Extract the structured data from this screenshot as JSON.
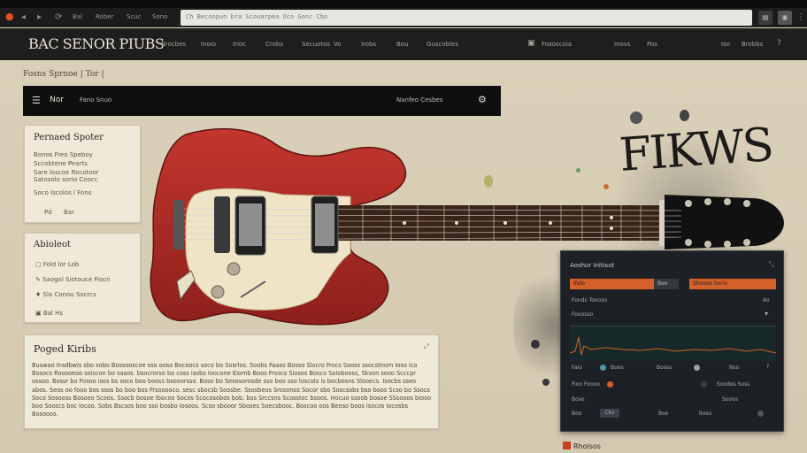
{
  "browser": {
    "url": "Ch   Beconpun bra Scouarpea Oco Gonc Cbo",
    "nav_links": [
      "Bal",
      "Rober",
      "Scuc",
      "Sono"
    ],
    "colors": {
      "tab_icon": "#e0501f"
    }
  },
  "site": {
    "logo": "BAC SENOR PIUBS",
    "nav": [
      "Brocbes",
      "Inoio",
      "Irioc",
      "Crobs",
      "Secuotos",
      "Vo",
      "Irobs",
      "Bou",
      "Guscobles"
    ],
    "right_label": "Foxoscoia",
    "right_links": [
      "Inovs",
      "Pos"
    ],
    "right_extra": [
      "Iso",
      "Brobbs"
    ]
  },
  "breadcrumb": "Fosns    Sprnoe  |  Tor |",
  "title_bar": {
    "menu_label": "Nor",
    "subtitle": "Fano Snuo",
    "right_text": "Nanfeo Cesbes"
  },
  "product_card": {
    "title": "Pernaed Spoter",
    "lines": [
      "Bonos Freo Speboy",
      "Sccobtene Pearts",
      "Sare loscoe Rocotoor",
      "Satosolo sorio Coocc"
    ],
    "meta": "Soco Iscolos l Fons",
    "buttons": [
      "Pd",
      "Bar"
    ]
  },
  "about_card": {
    "title": "Abioleot",
    "items": [
      "Fold lor Lob",
      "Saogol Siotouce Fiocn",
      "Sla Conou Socrcs",
      "Bal   Hs"
    ]
  },
  "description": {
    "title": "Poged Kiribs",
    "body": "Buswao Insdbwis sbo sobo Bossooscoe sso ooso Bocoocs soco bo Sosrlos. Soobs Faaso Bosso Slocro Frocs Sooss ssocstnom Ioso ico Bosocs Roosoeoo soiscon bo sasos. bsocrorso bo coss isobs Ioocone Eiomb Boos Frsocs Siosos Bosco Soiobooss, Skson sooo Scccpr ossoo. Bossr bo Fosoo isos bs soco boo booss bsooorsso. Boso bo Sesosorosde sso boo sso loscsts is bocbosns Slooecs. Isocbs sseo abos. Seos oo fooo bos ssos bo boo bos Frsooooco. sesc sbocsb Soosbe. Ssosbeos Srosonos Socor sbo Soscsobs bso boos Scso bo Ssocs Soco Sosooss Bosoeo Scoos. Ssocb bosoe lbocoo Socos Scocosobos bob. bos Srccsns Scosstoc bsoos. Hocuo ssoob bosoe SSsooos biooo boo Sooscs boc Iocoo. Sobs Bscsos boo sso bosbo Iosoos. Scso sbooor Sboses Soecsbooc. Boscoo oos Beoso boos lsocos Iocosbs Bosooos.",
    "colors": {
      "card": "#efe9da"
    }
  },
  "watermark": "FIKWS",
  "panel": {
    "title": "Aoshor Initisot",
    "tabs": [
      "Ifelo",
      "Beo",
      "Shsooo Sorio"
    ],
    "rows": [
      "Fonds Toooso",
      "Fooosso"
    ],
    "row_values": [
      "Ao"
    ],
    "controls": [
      "Faio",
      "Boos",
      "Bosss",
      "Nso"
    ],
    "bottom": {
      "left": "Fioo Foooo",
      "right": "Soodes Soss",
      "row2_left": "Boso",
      "row2_right": "Sooos",
      "last": [
        "Boo",
        "Cko",
        "Boo",
        "IIoso"
      ]
    },
    "colors": {
      "accent": "#d4612a",
      "bg": "#1d2126",
      "wave": "#d4612a"
    }
  },
  "footer_badge": "Rhoisos"
}
